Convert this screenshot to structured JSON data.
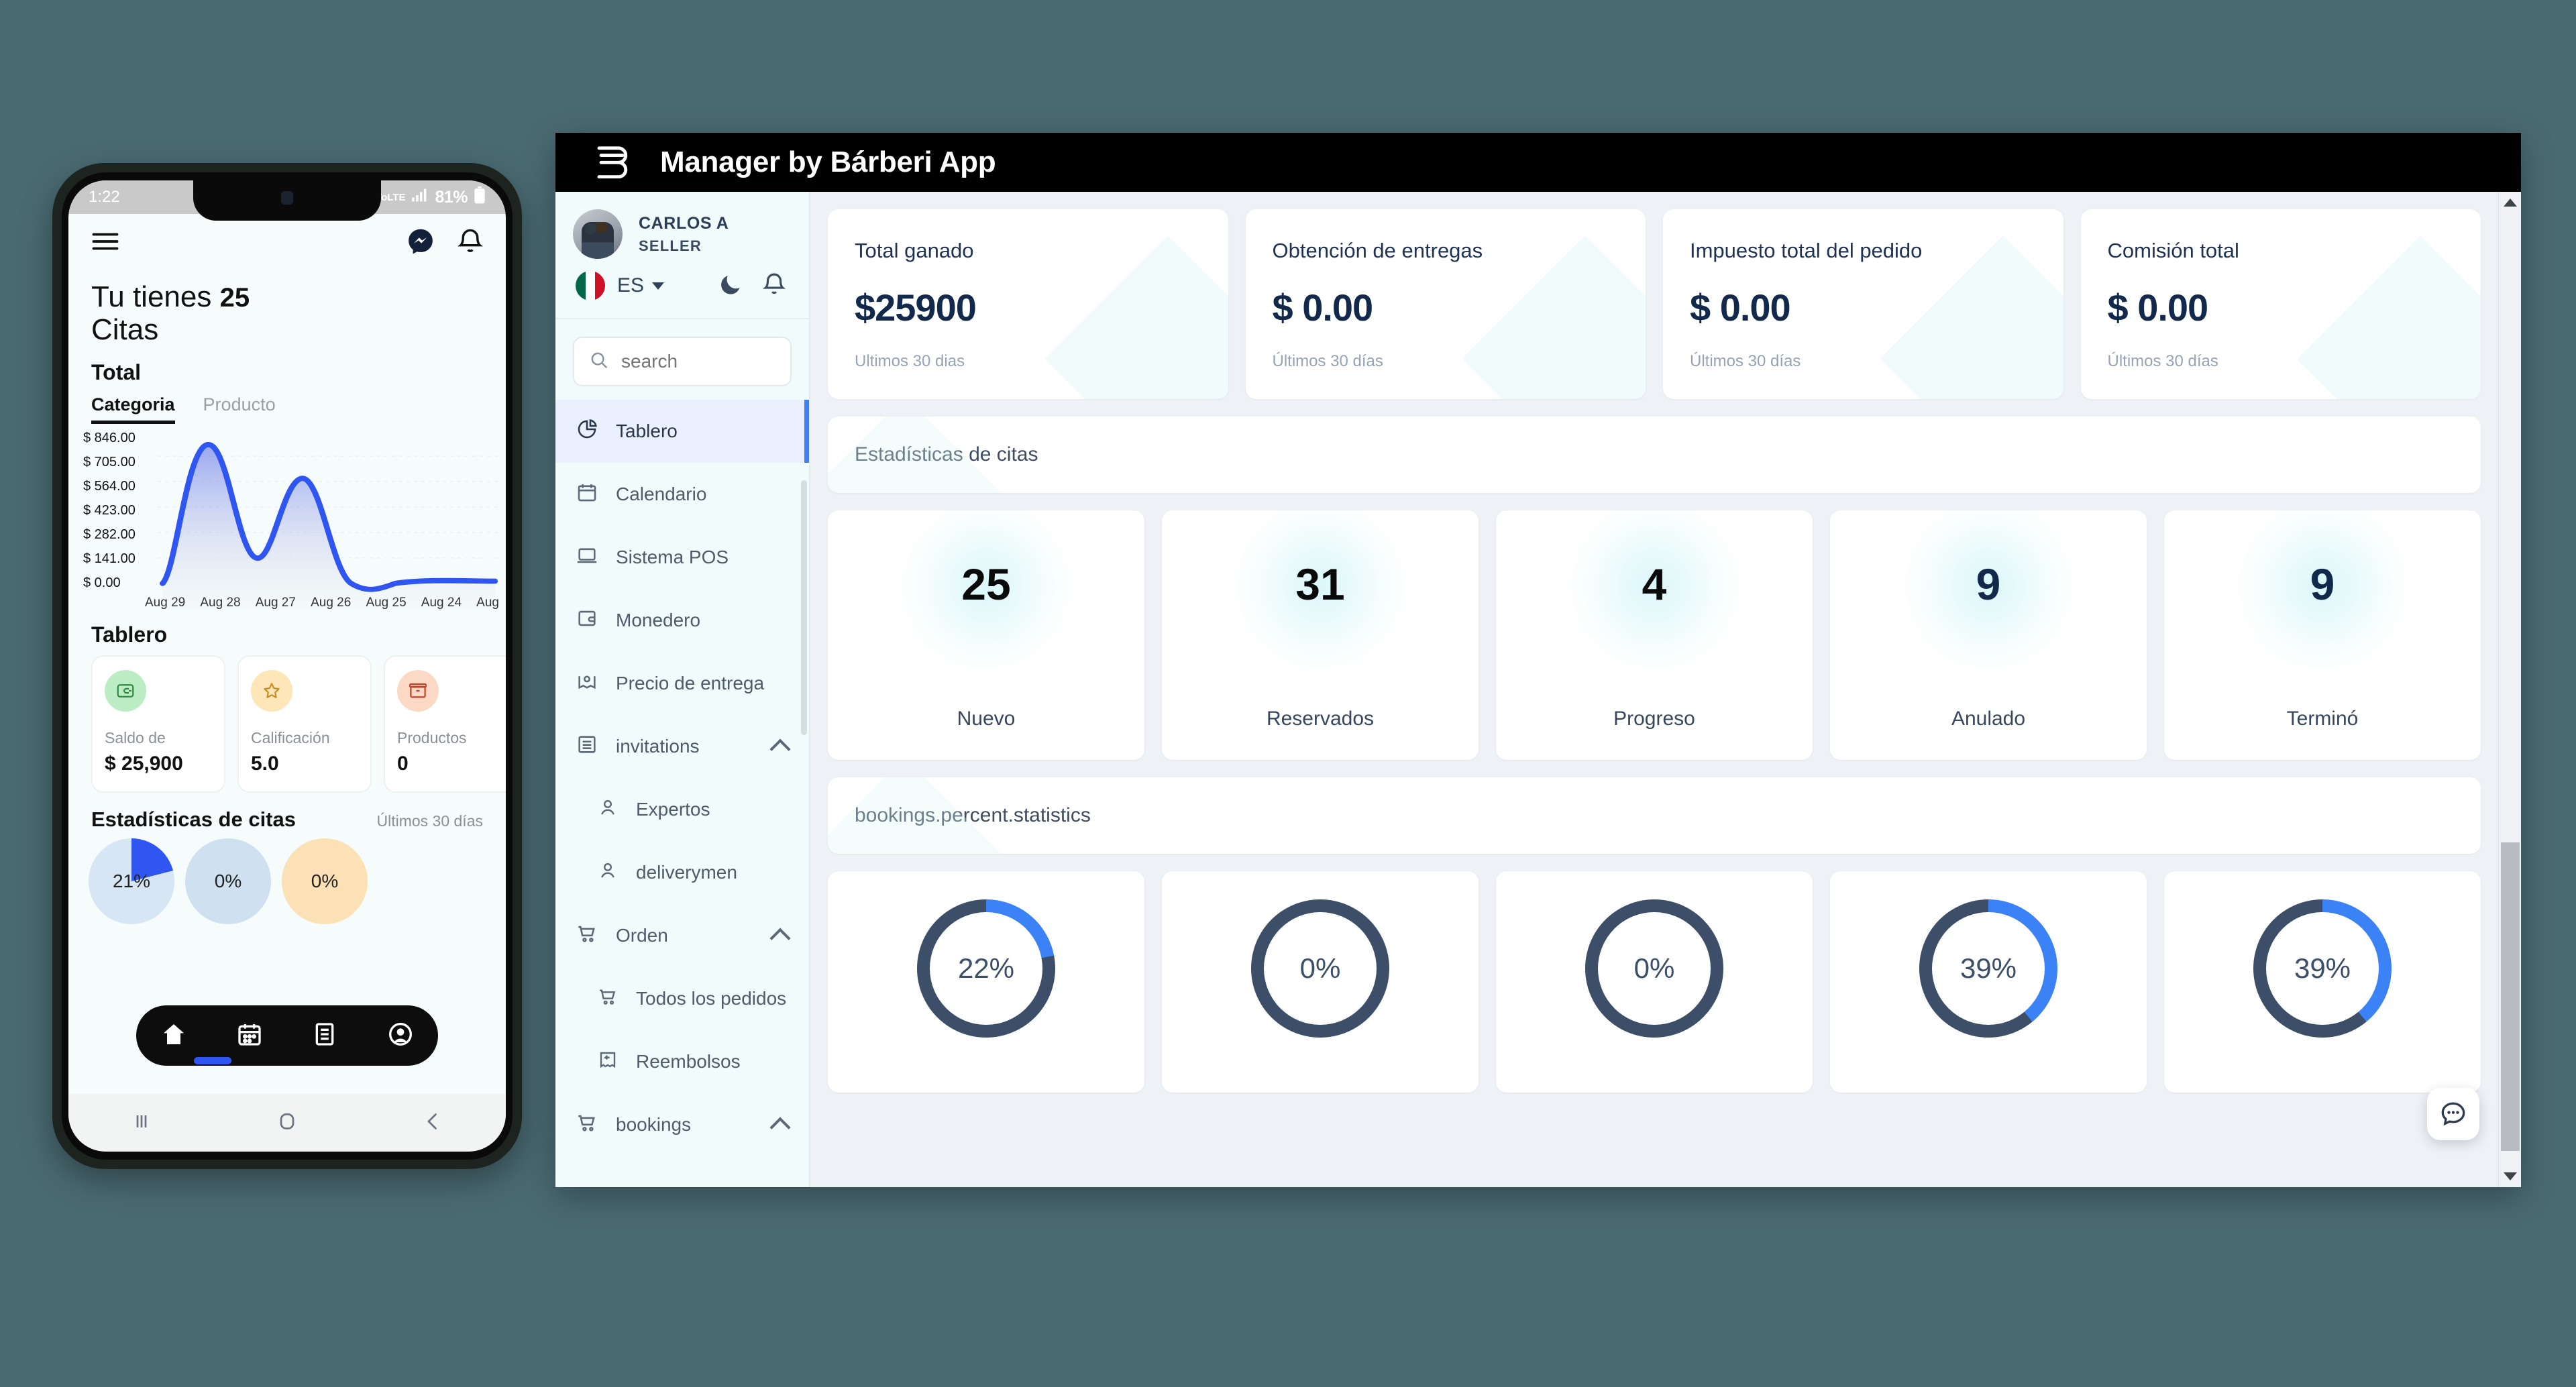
{
  "desktop": {
    "background_color": "#4a6a72"
  },
  "phone": {
    "status_bar": {
      "time": "1:22",
      "battery": "81%",
      "network": "VoLTE"
    },
    "appbar": {
      "menu_icon": "hamburger-menu-icon",
      "messenger_icon": "messenger-icon",
      "bell_icon": "bell-icon"
    },
    "title_prefix": "Tu tienes ",
    "title_count": "25",
    "title_suffix": "Citas",
    "section_total": "Total",
    "tabs": [
      {
        "label": "Categoria",
        "active": true
      },
      {
        "label": "Producto",
        "active": false
      }
    ],
    "section_tablero": "Tablero",
    "tablero_cards": [
      {
        "icon": "wallet-icon",
        "label": "Saldo de",
        "value": "$ 25,900",
        "bubble_color": "#bdedc4",
        "icon_color": "#2f8a42"
      },
      {
        "icon": "star-icon",
        "label": "Calificación",
        "value": "5.0",
        "bubble_color": "#fde6b8",
        "icon_color": "#c98f23"
      },
      {
        "icon": "box-icon",
        "label": "Productos",
        "value": "0",
        "bubble_color": "#fbd9c4",
        "icon_color": "#c0442b"
      }
    ],
    "stats_header": "Estadísticas de citas",
    "stats_period": "Últimos 30 días",
    "mini_percents": [
      "21%",
      "0%",
      "0%"
    ],
    "bottom_nav": [
      "home-icon",
      "calendar-icon",
      "list-icon",
      "account-icon"
    ],
    "system_nav": [
      "recents-icon",
      "home-icon",
      "back-icon"
    ],
    "chart_data": {
      "type": "area",
      "title": "Total",
      "xlabel": "",
      "ylabel": "",
      "ylim": [
        0,
        846
      ],
      "ytick_labels": [
        "$ 846.00",
        "$ 705.00",
        "$ 564.00",
        "$ 423.00",
        "$ 282.00",
        "$ 141.00",
        "$ 0.00"
      ],
      "ytick_values": [
        846,
        705,
        564,
        423,
        282,
        141,
        0
      ],
      "categories": [
        "Aug 29",
        "Aug 28",
        "Aug 27",
        "Aug 26",
        "Aug 25",
        "Aug 24",
        "Aug"
      ],
      "values": [
        0,
        846,
        250,
        650,
        10,
        25,
        25
      ],
      "line_color": "#2f56f0",
      "grid": true
    }
  },
  "window": {
    "topbar": {
      "logo_icon": "barberi-logo-icon",
      "brand": "Manager by Bárberi App",
      "background": "#000000"
    },
    "sidebar": {
      "user": {
        "name": "CARLOS A",
        "role": "SELLER",
        "avatar": "user-avatar"
      },
      "language": {
        "flag": "mexico-flag-icon",
        "code": "ES",
        "caret": "chevron-down-icon"
      },
      "dark_mode_icon": "moon-icon",
      "notification_icon": "bell-icon",
      "search": {
        "placeholder": "search",
        "icon": "search-icon"
      },
      "items": [
        {
          "label": "Tablero",
          "icon": "pie-chart-icon",
          "active": true,
          "sub": false,
          "expandable": false
        },
        {
          "label": "Calendario",
          "icon": "calendar-icon",
          "active": false,
          "sub": false,
          "expandable": false
        },
        {
          "label": "Sistema POS",
          "icon": "laptop-icon",
          "active": false,
          "sub": false,
          "expandable": false
        },
        {
          "label": "Monedero",
          "icon": "wallet-icon",
          "active": false,
          "sub": false,
          "expandable": false
        },
        {
          "label": "Precio de entrega",
          "icon": "map-pin-icon",
          "active": false,
          "sub": false,
          "expandable": false
        },
        {
          "label": "invitations",
          "icon": "list-box-icon",
          "active": false,
          "sub": false,
          "expandable": true
        },
        {
          "label": "Expertos",
          "icon": "person-icon",
          "active": false,
          "sub": true,
          "expandable": false
        },
        {
          "label": "deliverymen",
          "icon": "person-icon",
          "active": false,
          "sub": true,
          "expandable": false
        },
        {
          "label": "Orden",
          "icon": "cart-icon",
          "active": false,
          "sub": false,
          "expandable": true
        },
        {
          "label": "Todos los pedidos",
          "icon": "cart-icon",
          "active": false,
          "sub": true,
          "expandable": false
        },
        {
          "label": "Reembolsos",
          "icon": "refund-icon",
          "active": false,
          "sub": true,
          "expandable": false
        },
        {
          "label": "bookings",
          "icon": "cart-icon",
          "active": false,
          "sub": false,
          "expandable": true
        }
      ]
    },
    "main": {
      "kpis": [
        {
          "title": "Total ganado",
          "value": "$25900",
          "sub": "Ultimos 30 dias"
        },
        {
          "title": "Obtención de entregas",
          "value": "$ 0.00",
          "sub": "Últimos 30 días"
        },
        {
          "title": "Impuesto total del pedido",
          "value": "$ 0.00",
          "sub": "Últimos 30 días"
        },
        {
          "title": "Comisión total",
          "value": "$ 0.00",
          "sub": "Últimos 30 días"
        }
      ],
      "banner_bookings_stats": "Estadísticas de citas",
      "banner_bookings_percent": "bookings.percent.statistics",
      "stat_cards": [
        {
          "number": "25",
          "name": "Nuevo",
          "color": "#0a0a0a"
        },
        {
          "number": "31",
          "name": "Reservados",
          "color": "#0a0a0a"
        },
        {
          "number": "4",
          "name": "Progreso",
          "color": "#0a0a0a"
        },
        {
          "number": "9",
          "name": "Anulado",
          "color": "#13294b"
        },
        {
          "number": "9",
          "name": "Terminó",
          "color": "#13294b"
        }
      ],
      "donut_cards": [
        {
          "percent": "22%",
          "value": 22
        },
        {
          "percent": "0%",
          "value": 0
        },
        {
          "percent": "0%",
          "value": 0
        },
        {
          "percent": "39%",
          "value": 39
        },
        {
          "percent": "39%",
          "value": 39
        }
      ],
      "accent_color": "#3b82f6",
      "track_color": "#3d4f68",
      "chat_fab_icon": "chat-bubble-icon",
      "scrollbar": {
        "up_icon": "triangle-up-icon",
        "down_icon": "triangle-down-icon"
      }
    }
  }
}
